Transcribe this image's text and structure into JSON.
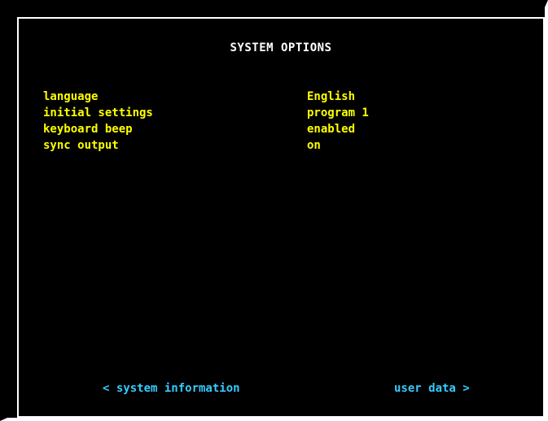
{
  "screen": {
    "title": "SYSTEM OPTIONS"
  },
  "options": [
    {
      "label": "language",
      "value": "English"
    },
    {
      "label": "initial settings",
      "value": "program 1"
    },
    {
      "label": "keyboard beep",
      "value": "enabled"
    },
    {
      "label": "sync output",
      "value": "on"
    }
  ],
  "nav": {
    "prev_label": "< system information",
    "next_label": "user data >"
  },
  "colors": {
    "background": "#000000",
    "title": "#ffffff",
    "option_text": "#ffff00",
    "nav_text": "#33ccff",
    "frame": "#ffffff"
  }
}
